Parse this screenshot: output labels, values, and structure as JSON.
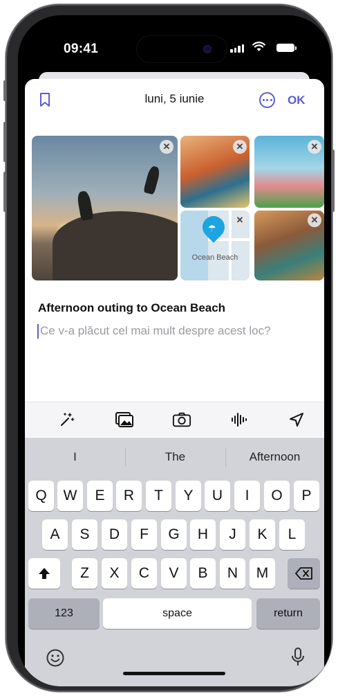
{
  "status": {
    "time": "09:41"
  },
  "header": {
    "date": "luni, 5 iunie",
    "ok_label": "OK"
  },
  "photos": {
    "map_label": "Ocean Beach",
    "remove_glyph": "✕"
  },
  "entry": {
    "title": "Afternoon outing to Ocean Beach",
    "prompt_placeholder": "Ce v-a plăcut cel mai mult despre acest loc?"
  },
  "toolbar": {
    "icons": [
      "magic-wand-icon",
      "photo-library-icon",
      "camera-icon",
      "audio-waveform-icon",
      "location-arrow-icon"
    ]
  },
  "keyboard": {
    "suggestions": [
      "I",
      "The",
      "Afternoon"
    ],
    "row1": [
      "Q",
      "W",
      "E",
      "R",
      "T",
      "Y",
      "U",
      "I",
      "O",
      "P"
    ],
    "row2": [
      "A",
      "S",
      "D",
      "F",
      "G",
      "H",
      "J",
      "K",
      "L"
    ],
    "row3": [
      "Z",
      "X",
      "C",
      "V",
      "B",
      "N",
      "M"
    ],
    "numbers_label": "123",
    "space_label": "space",
    "return_label": "return"
  },
  "colors": {
    "accent": "#5b5bd6",
    "keyboard_bg": "#d1d3d9"
  }
}
